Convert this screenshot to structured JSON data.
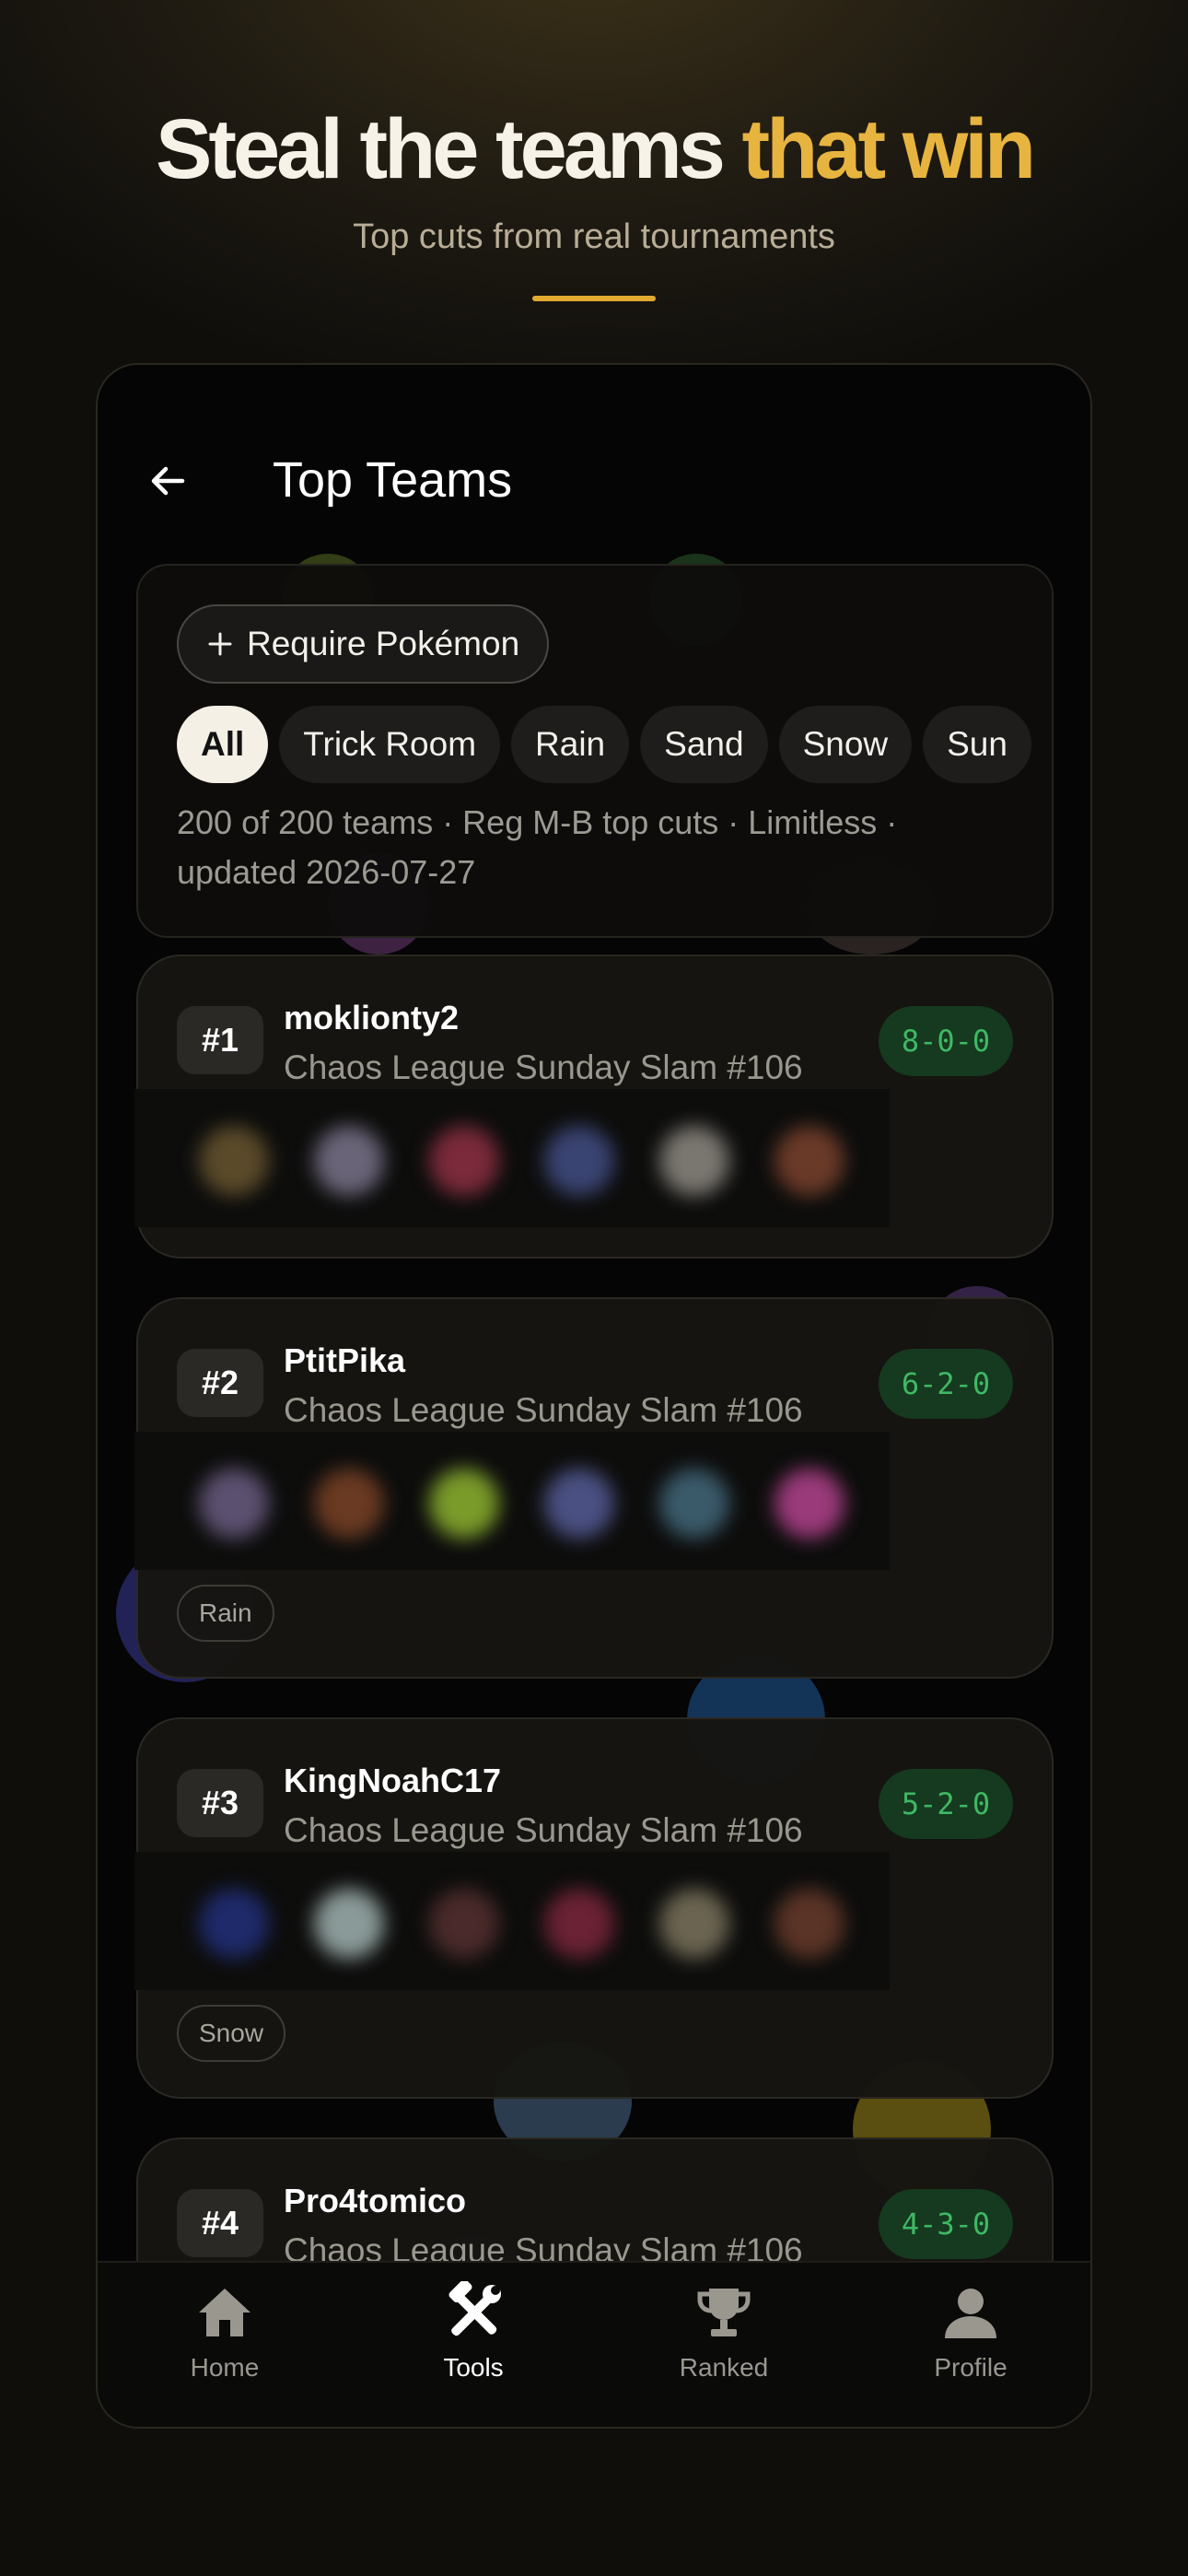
{
  "hero": {
    "title_main": "Steal the teams ",
    "title_accent": "that win",
    "subtitle": "Top cuts from real tournaments"
  },
  "header": {
    "back_icon": "arrow-left-icon",
    "title": "Top Teams"
  },
  "filters": {
    "require_label": "Require Pokémon",
    "require_icon": "plus-icon",
    "chips": [
      {
        "label": "All",
        "active": true
      },
      {
        "label": "Trick Room",
        "active": false
      },
      {
        "label": "Rain",
        "active": false
      },
      {
        "label": "Sand",
        "active": false
      },
      {
        "label": "Snow",
        "active": false
      },
      {
        "label": "Sun",
        "active": false
      }
    ],
    "meta": "200 of 200 teams · Reg M-B top cuts · Limitless · updated 2026-07-27"
  },
  "teams": [
    {
      "rank": "#1",
      "player": "moklionty2",
      "event": "Chaos League Sunday Slam #106",
      "record": "8-0-0",
      "tag": ""
    },
    {
      "rank": "#2",
      "player": "PtitPika",
      "event": "Chaos League Sunday Slam #106",
      "record": "6-2-0",
      "tag": "Rain"
    },
    {
      "rank": "#3",
      "player": "KingNoahC17",
      "event": "Chaos League Sunday Slam #106",
      "record": "5-2-0",
      "tag": "Snow"
    },
    {
      "rank": "#4",
      "player": "Pro4tomico",
      "event": "Chaos League Sunday Slam #106",
      "record": "4-3-0",
      "tag": ""
    }
  ],
  "tabs": [
    {
      "label": "Home",
      "icon": "home-icon",
      "active": false
    },
    {
      "label": "Tools",
      "icon": "tools-icon",
      "active": true
    },
    {
      "label": "Ranked",
      "icon": "trophy-icon",
      "active": false
    },
    {
      "label": "Profile",
      "icon": "profile-icon",
      "active": false
    }
  ],
  "colors": {
    "accent": "#e7b43f",
    "record_text": "#3fb864",
    "record_bg": "#153a1f"
  }
}
